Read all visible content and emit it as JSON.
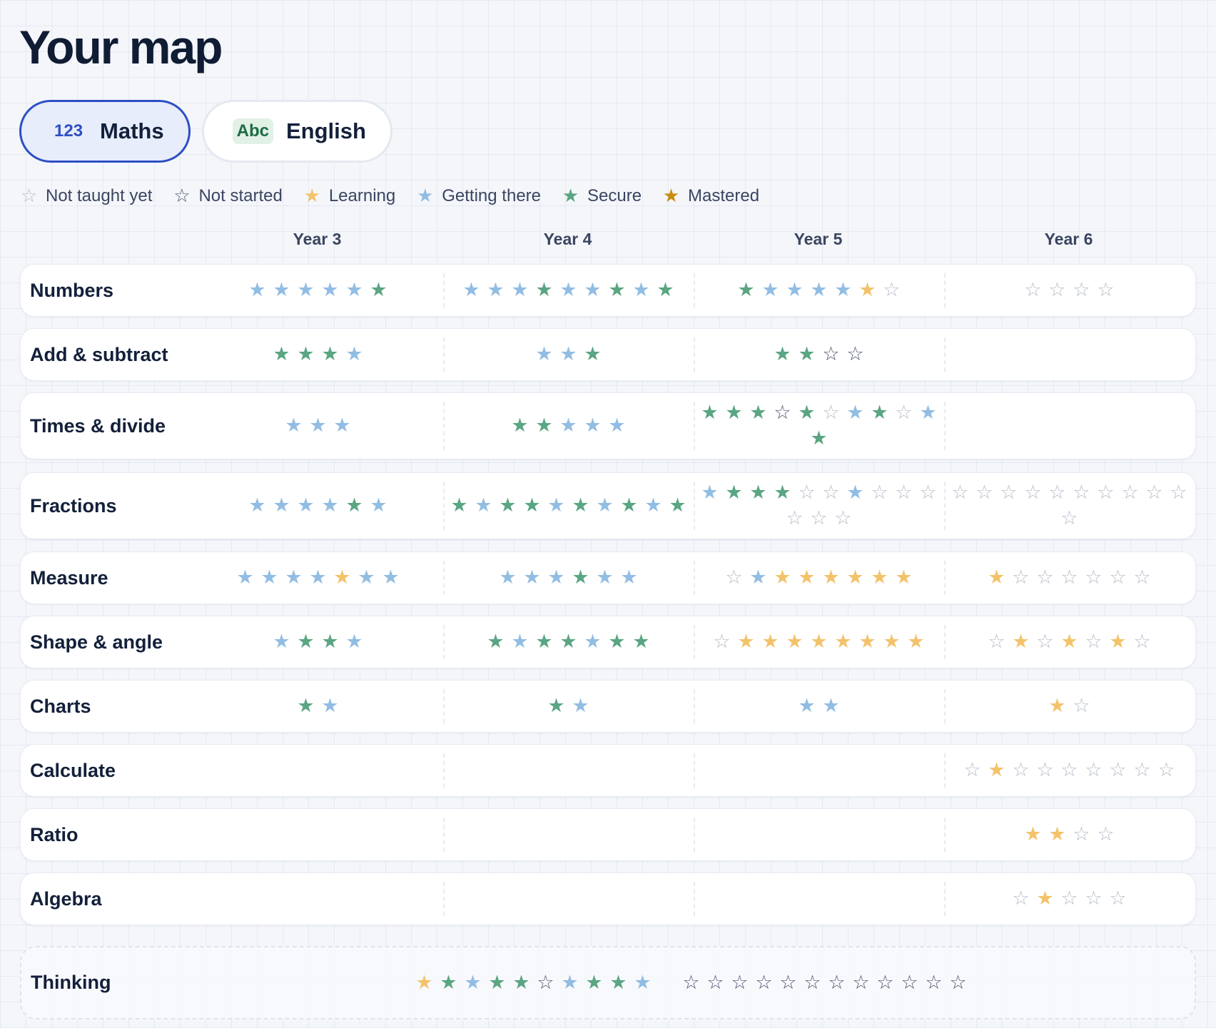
{
  "page": {
    "title": "Your map"
  },
  "subject_tabs": [
    {
      "badge": "123",
      "label": "Maths",
      "active": true
    },
    {
      "badge": "Abc",
      "label": "English",
      "active": false
    }
  ],
  "legend": [
    {
      "status": "not_taught",
      "label": "Not taught yet"
    },
    {
      "status": "not_started",
      "label": "Not started"
    },
    {
      "status": "learning",
      "label": "Learning"
    },
    {
      "status": "getting_there",
      "label": "Getting there"
    },
    {
      "status": "secure",
      "label": "Secure"
    },
    {
      "status": "mastered",
      "label": "Mastered"
    }
  ],
  "status_styles": {
    "not_taught": {
      "glyph": "☆",
      "color": "#b6bcc8"
    },
    "not_started": {
      "glyph": "☆",
      "color": "#4e5870"
    },
    "learning": {
      "glyph": "★",
      "color": "#f3c36b"
    },
    "getting_there": {
      "glyph": "★",
      "color": "#92bde3"
    },
    "secure": {
      "glyph": "★",
      "color": "#5aa582"
    },
    "mastered": {
      "glyph": "★",
      "color": "#c78d12"
    }
  },
  "years": [
    "Year 3",
    "Year 4",
    "Year 5",
    "Year 6"
  ],
  "rows": [
    {
      "label": "Numbers",
      "cells": [
        [
          "G",
          "G",
          "G",
          "G",
          "G",
          "S"
        ],
        [
          "G",
          "G",
          "G",
          "S",
          "G",
          "G",
          "S",
          "G",
          "S"
        ],
        [
          "S",
          "G",
          "G",
          "G",
          "G",
          "L",
          "T"
        ],
        [
          "T",
          "T",
          "T",
          "T"
        ]
      ]
    },
    {
      "label": "Add & subtract",
      "cells": [
        [
          "S",
          "S",
          "S",
          "G"
        ],
        [
          "G",
          "G",
          "S"
        ],
        [
          "S",
          "S",
          "N",
          "N"
        ],
        []
      ]
    },
    {
      "label": "Times & divide",
      "cells": [
        [
          "G",
          "G",
          "G"
        ],
        [
          "S",
          "S",
          "G",
          "G",
          "G"
        ],
        [
          "S",
          "S",
          "S",
          "N",
          "S",
          "T",
          "G",
          "S",
          "T",
          "G",
          "S"
        ],
        []
      ]
    },
    {
      "label": "Fractions",
      "cells": [
        [
          "G",
          "G",
          "G",
          "G",
          "S",
          "G"
        ],
        [
          "S",
          "G",
          "S",
          "S",
          "G",
          "S",
          "G",
          "S",
          "G",
          "S"
        ],
        [
          "G",
          "S",
          "S",
          "S",
          "T",
          "T",
          "G",
          "T",
          "T",
          "T",
          "T",
          "T",
          "T"
        ],
        [
          "T",
          "T",
          "T",
          "T",
          "T",
          "T",
          "T",
          "T",
          "T",
          "T",
          "T"
        ]
      ]
    },
    {
      "label": "Measure",
      "cells": [
        [
          "G",
          "G",
          "G",
          "G",
          "L",
          "G",
          "G"
        ],
        [
          "G",
          "G",
          "G",
          "S",
          "G",
          "G"
        ],
        [
          "T",
          "G",
          "L",
          "L",
          "L",
          "L",
          "L",
          "L"
        ],
        [
          "L",
          "T",
          "T",
          "T",
          "T",
          "T",
          "T"
        ]
      ]
    },
    {
      "label": "Shape & angle",
      "cells": [
        [
          "G",
          "S",
          "S",
          "G"
        ],
        [
          "S",
          "G",
          "S",
          "S",
          "G",
          "S",
          "S"
        ],
        [
          "T",
          "L",
          "L",
          "L",
          "L",
          "L",
          "L",
          "L",
          "L"
        ],
        [
          "T",
          "L",
          "T",
          "L",
          "T",
          "L",
          "T"
        ]
      ]
    },
    {
      "label": "Charts",
      "cells": [
        [
          "S",
          "G"
        ],
        [
          "S",
          "G"
        ],
        [
          "G",
          "G"
        ],
        [
          "L",
          "T"
        ]
      ]
    },
    {
      "label": "Calculate",
      "cells": [
        [],
        [],
        [],
        [
          "T",
          "L",
          "T",
          "T",
          "T",
          "T",
          "T",
          "T",
          "T"
        ]
      ]
    },
    {
      "label": "Ratio",
      "cells": [
        [],
        [],
        [],
        [
          "L",
          "L",
          "T",
          "T"
        ]
      ]
    },
    {
      "label": "Algebra",
      "cells": [
        [],
        [],
        [],
        [
          "T",
          "L",
          "T",
          "T",
          "T"
        ]
      ]
    }
  ],
  "thinking": {
    "label": "Thinking",
    "groups": [
      [
        "L",
        "S",
        "G",
        "S",
        "S",
        "N",
        "G",
        "S",
        "S",
        "G"
      ],
      [
        "N",
        "N",
        "N",
        "N",
        "N",
        "N",
        "N",
        "N",
        "N",
        "N",
        "N",
        "N"
      ]
    ]
  },
  "status_codes": {
    "T": "not_taught",
    "N": "not_started",
    "L": "learning",
    "G": "getting_there",
    "S": "secure",
    "M": "mastered"
  }
}
